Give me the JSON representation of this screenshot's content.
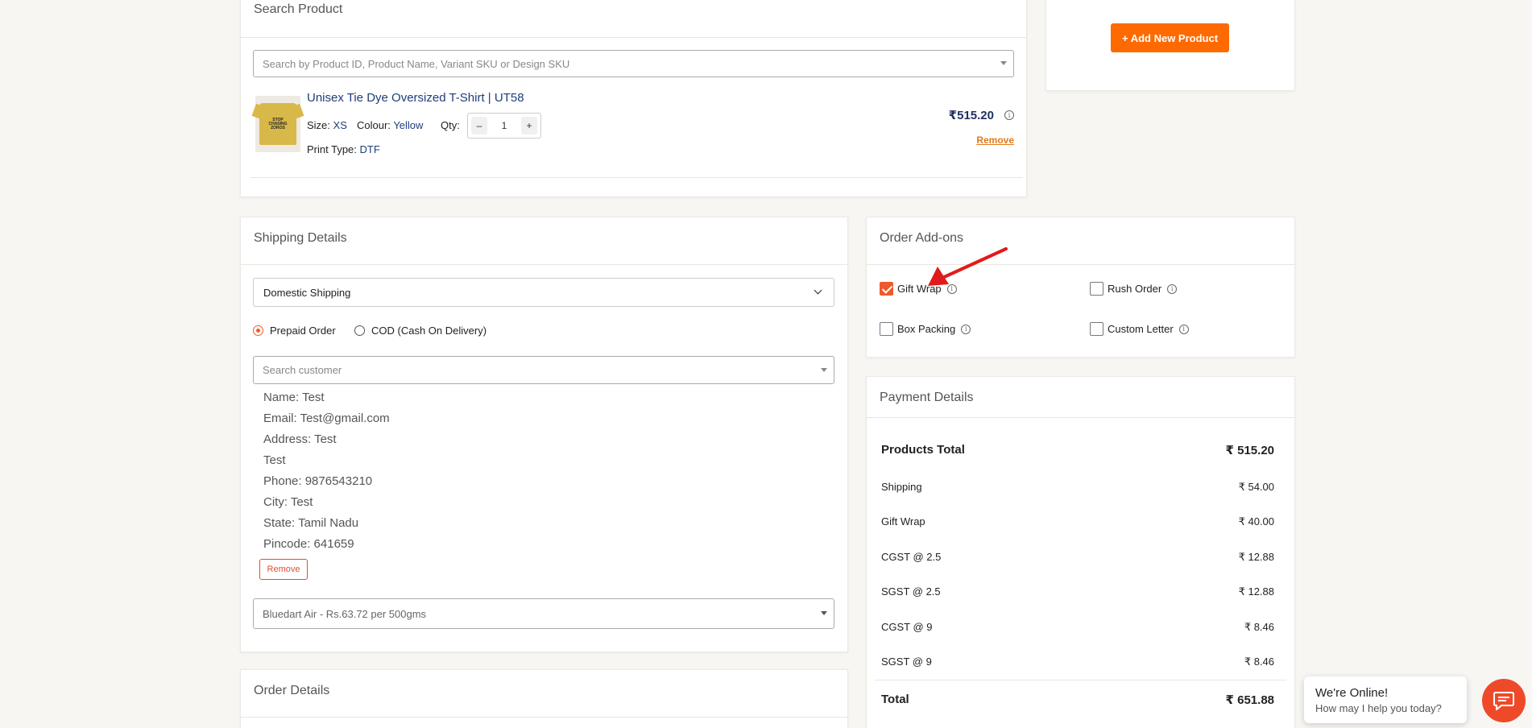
{
  "search_product": {
    "title": "Search Product",
    "placeholder": "Search by Product ID, Product Name, Variant SKU or Design SKU",
    "item": {
      "name": "Unisex Tie Dye Oversized T-Shirt | UT58",
      "size_label": "Size:",
      "size": "XS",
      "colour_label": "Colour:",
      "colour": "Yellow",
      "qty_label": "Qty:",
      "qty": "1",
      "minus": "–",
      "plus": "+",
      "print_label": "Print Type:",
      "print": "DTF",
      "price": "₹515.20",
      "remove": "Remove",
      "thumb_text": [
        "STOP",
        "CHASING",
        "ZOROS"
      ]
    }
  },
  "add_new": {
    "label": "+ Add New Product"
  },
  "shipping": {
    "title": "Shipping Details",
    "type": "Domestic Shipping",
    "payment_options": [
      "Prepaid Order",
      "COD (Cash On Delivery)"
    ],
    "selected_payment": "Prepaid Order",
    "customer_placeholder": "Search customer",
    "customer": {
      "name": "Name: Test",
      "email": "Email: Test@gmail.com",
      "address": "Address: Test",
      "address2": "Test",
      "phone": "Phone: 9876543210",
      "city": "City: Test",
      "state": "State: Tamil Nadu",
      "pincode": "Pincode: 641659"
    },
    "remove": "Remove",
    "courier": "Bluedart Air - Rs.63.72 per 500gms"
  },
  "order_details": {
    "title": "Order Details"
  },
  "addons": {
    "title": "Order Add-ons",
    "items": [
      {
        "label": "Gift Wrap",
        "checked": true
      },
      {
        "label": "Rush Order",
        "checked": false
      },
      {
        "label": "Box Packing",
        "checked": false
      },
      {
        "label": "Custom Letter",
        "checked": false
      }
    ]
  },
  "payment": {
    "title": "Payment Details",
    "rows": [
      {
        "label": "Products Total",
        "value": "₹ 515.20"
      },
      {
        "label": "Shipping",
        "value": "₹ 54.00"
      },
      {
        "label": "Gift Wrap",
        "value": "₹ 40.00"
      },
      {
        "label": "CGST @ 2.5",
        "value": "₹ 12.88"
      },
      {
        "label": "SGST @ 2.5",
        "value": "₹ 12.88"
      },
      {
        "label": "CGST @ 9",
        "value": "₹ 8.46"
      },
      {
        "label": "SGST @ 9",
        "value": "₹ 8.46"
      }
    ],
    "total_label": "Total",
    "total_value": "₹ 651.88"
  },
  "chat": {
    "title": "We're Online!",
    "subtitle": "How may I help you today?"
  },
  "colors": {
    "accent": "#ee5a2a",
    "button_orange": "#ff6a00",
    "link_blue": "#1f3d7a",
    "arrow_red": "#e01b1b"
  }
}
